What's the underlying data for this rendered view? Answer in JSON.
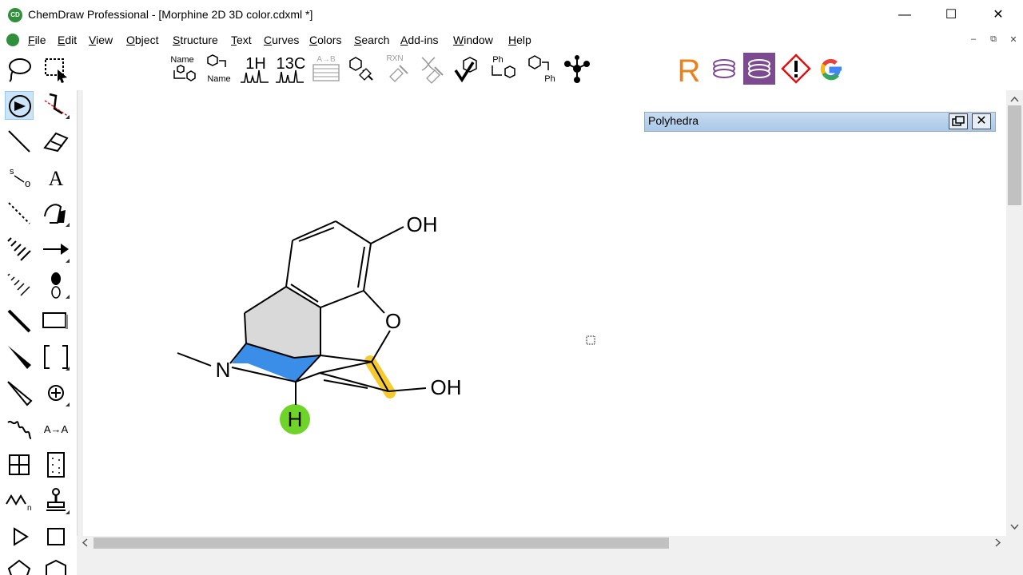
{
  "window": {
    "title": "ChemDraw Professional - [Morphine 2D 3D color.cdxml *]",
    "app_icon": "CD",
    "minimize_glyph": "—",
    "maximize_glyph": "☐",
    "close_glyph": "✕"
  },
  "menubar": {
    "items": [
      {
        "first": "F",
        "rest": "ile"
      },
      {
        "first": "E",
        "rest": "dit"
      },
      {
        "first": "V",
        "rest": "iew"
      },
      {
        "first": "O",
        "rest": "bject"
      },
      {
        "first": "S",
        "rest": "tructure"
      },
      {
        "first": "T",
        "rest": "ext"
      },
      {
        "first": "C",
        "rest": "urves"
      },
      {
        "first": "C",
        "rest": "olors"
      },
      {
        "first": "S",
        "rest": "earch"
      },
      {
        "first": "A",
        "rest": "dd-ins"
      },
      {
        "first": "W",
        "rest": "indow"
      },
      {
        "first": "H",
        "rest": "elp"
      }
    ],
    "mdi_min": "–",
    "mdi_restore": "⧉",
    "mdi_close": "✕"
  },
  "toolbar": {
    "name_to_struct_label": "Name",
    "struct_to_name_label": "Name",
    "h1_label": "1H",
    "c13_label": "13C",
    "a_to_b_label": "A→B",
    "rxn_label": "RXN",
    "ph_label_a": "Ph",
    "ph_label_b": "Ph",
    "r_label": "R",
    "accent_r": "#e8821e",
    "accent_purple": "#7b4a8f"
  },
  "palette": {
    "text_tool_label": "A",
    "a_to_a_label": "A→A",
    "s_label": "s",
    "o_label": "o",
    "n_label": "n"
  },
  "molecule": {
    "atoms": {
      "oh_top": "OH",
      "o_ring": "O",
      "oh_right": "OH",
      "n": "N",
      "h": "H"
    },
    "colors": {
      "gray_fill": "#d9d9d9",
      "blue_fill": "#3b8ee8",
      "yellow_highlight": "#f5c518",
      "green_atom": "#6fd42a"
    }
  },
  "panel": {
    "title": "Polyhedra",
    "close_glyph": "✕"
  }
}
